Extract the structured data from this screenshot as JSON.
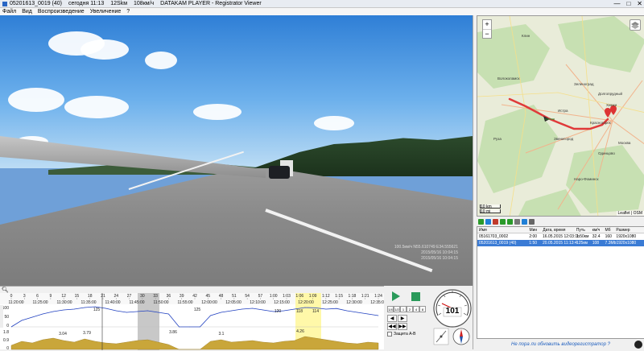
{
  "titlebar": {
    "segments": [
      "05201613_0019 (40)",
      "сегодня 11:13",
      "12Skм",
      "108км/ч",
      "DATAKAM PLAYER - Registrator Viewer"
    ],
    "buttons": [
      "—",
      "□",
      "✕"
    ]
  },
  "menu": [
    "Файл",
    "Вид",
    "Воспроизведение",
    "Увеличение",
    "?"
  ],
  "video": {
    "overlay_lines": [
      "100.5км/ч N55.610749 E34.555621",
      "2015/05/16 10:04:15",
      "2015/05/16 10:04:15"
    ]
  },
  "timeline": {
    "toolbar_icon": "magnifier-icon",
    "ruler_hours": [
      "11:20:00",
      "11:25:00",
      "11:30:00",
      "11:35:00",
      "11:40:00",
      "11:45:00",
      "11:50:00",
      "11:55:00",
      "12:00:00",
      "12:05:00",
      "12:10:00",
      "12:15:00",
      "12:20:00",
      "12:25:00",
      "12:30:00",
      "12:35:00"
    ],
    "ruler_ticks": [
      "0",
      "3",
      "6",
      "9",
      "12",
      "15",
      "18",
      "21",
      "24",
      "27",
      "30",
      "33",
      "36",
      "39",
      "42",
      "45",
      "48",
      "51",
      "54",
      "57",
      "1:00",
      "1:03",
      "1:06",
      "1:09",
      "1:12",
      "1:15",
      "1:18",
      "1:21",
      "1:24"
    ],
    "speed_axis": [
      "100",
      "50",
      "0"
    ],
    "speed_peaks": [
      "125",
      "125",
      "120",
      "118",
      "114"
    ],
    "accel_axis": [
      "1.8",
      "0.9",
      "0"
    ],
    "accel_peaks": [
      "3.04",
      "3.79",
      "3.86",
      "3.1",
      "4.26"
    ],
    "chart_data": {
      "type": "line",
      "series": [
        {
          "values": [
            0,
            40,
            60,
            80,
            95,
            105,
            110,
            120,
            125,
            115,
            100,
            90,
            95,
            100,
            90,
            80,
            0,
            0,
            0,
            70,
            90,
            100,
            110,
            115,
            105,
            95,
            100,
            110,
            120,
            118,
            110,
            114,
            100,
            90,
            80,
            70
          ]
        },
        {
          "values": [
            0.5,
            1.0,
            0.8,
            1.2,
            1.4,
            1.1,
            0.9,
            1.3,
            1.0,
            0.8,
            0.7,
            0.9,
            1.1,
            1.2,
            0.9,
            0.6,
            0,
            0,
            0,
            1.0,
            1.2,
            0.9,
            1.0,
            1.1,
            0.9,
            0.8,
            1.0,
            1.1,
            1.6,
            1.4,
            1.2,
            1.0,
            0.8,
            0.7,
            0.9,
            0.8
          ]
        }
      ],
      "ylim": [
        0,
        130
      ]
    }
  },
  "controls": {
    "play_icon": "play-icon",
    "stop_icon": "stop-icon",
    "small_buttons": [
      "1/4",
      "1/2",
      "1",
      "2",
      "4",
      "8"
    ],
    "nav_buttons": [
      "◀",
      "▶",
      "◀◀",
      "▶▶"
    ],
    "checkbox_label": "Защита A-B"
  },
  "speedo": {
    "value": "101",
    "gauge_marks": [
      "0",
      "40",
      "80",
      "120",
      "160"
    ],
    "compass_icon": "compass-icon",
    "gsensor_icon": "g-sensor-icon"
  },
  "map": {
    "zoom_in": "+",
    "zoom_out": "−",
    "scale": [
      "10 km",
      "10 mi"
    ],
    "attribution": "Leaflet | OSM",
    "labels": [
      "Клин",
      "Зеленоград",
      "Долгопрудный",
      "Химки",
      "Красногорск",
      "Москва",
      "Одинцово",
      "Истра",
      "Наро-Фоминск",
      "Руза",
      "Волоколамск",
      "Звенигород"
    ]
  },
  "list": {
    "toolbar_icons": [
      "open-icon",
      "add-icon",
      "remove-icon",
      "up-icon",
      "down-icon",
      "sort-icon",
      "map-icon",
      "settings-icon"
    ],
    "headers": [
      "Имя",
      "Мин",
      "Дата, время",
      "Путь",
      "км/ч",
      "Мб",
      "Размер"
    ],
    "rows": [
      [
        "05161703_0002",
        "2:00",
        "16.05.2015 12:03:1b",
        "1.50км",
        "32.4",
        "160",
        "1920x1080"
      ],
      [
        "05201613_0019 (40)",
        "1:50",
        "20.05.2015 11:13:4",
        "125км",
        "108",
        "7.3Mb",
        "1920x1080"
      ]
    ],
    "selected_index": 1
  },
  "promo": "Не пора ли обновить видеорегистратор ?"
}
